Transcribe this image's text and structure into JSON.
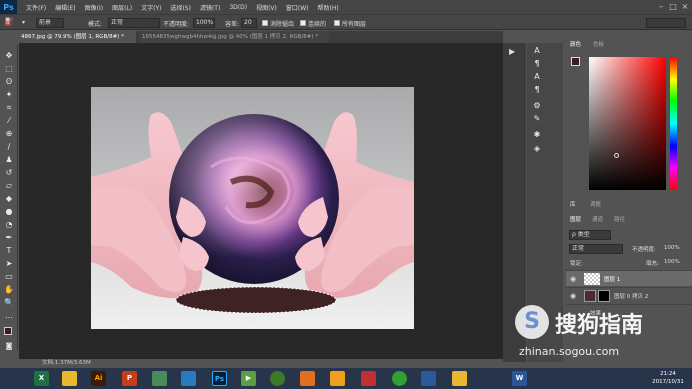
{
  "app": {
    "logo": "Ps"
  },
  "menu": [
    "文件(F)",
    "编辑(E)",
    "图像(I)",
    "图层(L)",
    "文字(Y)",
    "选择(S)",
    "滤镜(T)",
    "3D(D)",
    "视图(V)",
    "窗口(W)",
    "帮助(H)"
  ],
  "options": {
    "preset_label": "前景",
    "mode_label": "模式:",
    "mode_value": "正常",
    "opacity_label": "不透明度:",
    "opacity_value": "100%",
    "tolerance_label": "容差:",
    "tolerance_value": "20",
    "antialias_label": "消除锯齿",
    "contiguous_label": "连续的",
    "all_layers_label": "所有图层"
  },
  "tabs": [
    {
      "label": "4867.jpg @ 79.9% (图层 1, RGB/8#) *",
      "active": true
    },
    {
      "label": "16554835wghwgb4hhw4qj.jpg @ 40% (图层 1 拷贝 2, RGB/8#) *",
      "active": false
    }
  ],
  "status": {
    "text": "文档:1.37M/3.63M"
  },
  "panels": {
    "color_tabs": [
      "颜色",
      "色板"
    ],
    "lib_tabs": [
      "库",
      "调整"
    ],
    "layer_tabs": [
      "图层",
      "通道",
      "路径"
    ],
    "kind_label": "ρ 类型",
    "blend_value": "正常",
    "opacity_label": "不透明度:",
    "opacity_value": "100%",
    "lock_label": "锁定:",
    "fill_label": "填充:",
    "fill_value": "100%",
    "layers": [
      {
        "name": "图层 1",
        "selected": true
      },
      {
        "name": "图层 0 拷贝 2",
        "selected": false
      },
      {
        "name": "效果",
        "selected": false
      }
    ]
  },
  "taskbar": {
    "apps": [
      "excel-icon",
      "folder-icon",
      "illustrator-icon",
      "powerpoint-icon",
      "photo-icon",
      "media-icon",
      "photoshop-icon",
      "play-icon",
      "browser-icon",
      "tool-icon",
      "app2-icon",
      "pen-icon",
      "green-icon",
      "wifi-icon",
      "folder2-icon",
      "word-icon"
    ],
    "time": "21:24",
    "date": "2017/10/31"
  },
  "watermark": {
    "cn": "搜狗指南",
    "url": "zhinan.sogou.com"
  },
  "colors": {
    "accent": "#31a8ff",
    "fg_swatch": "#3a1e22"
  }
}
